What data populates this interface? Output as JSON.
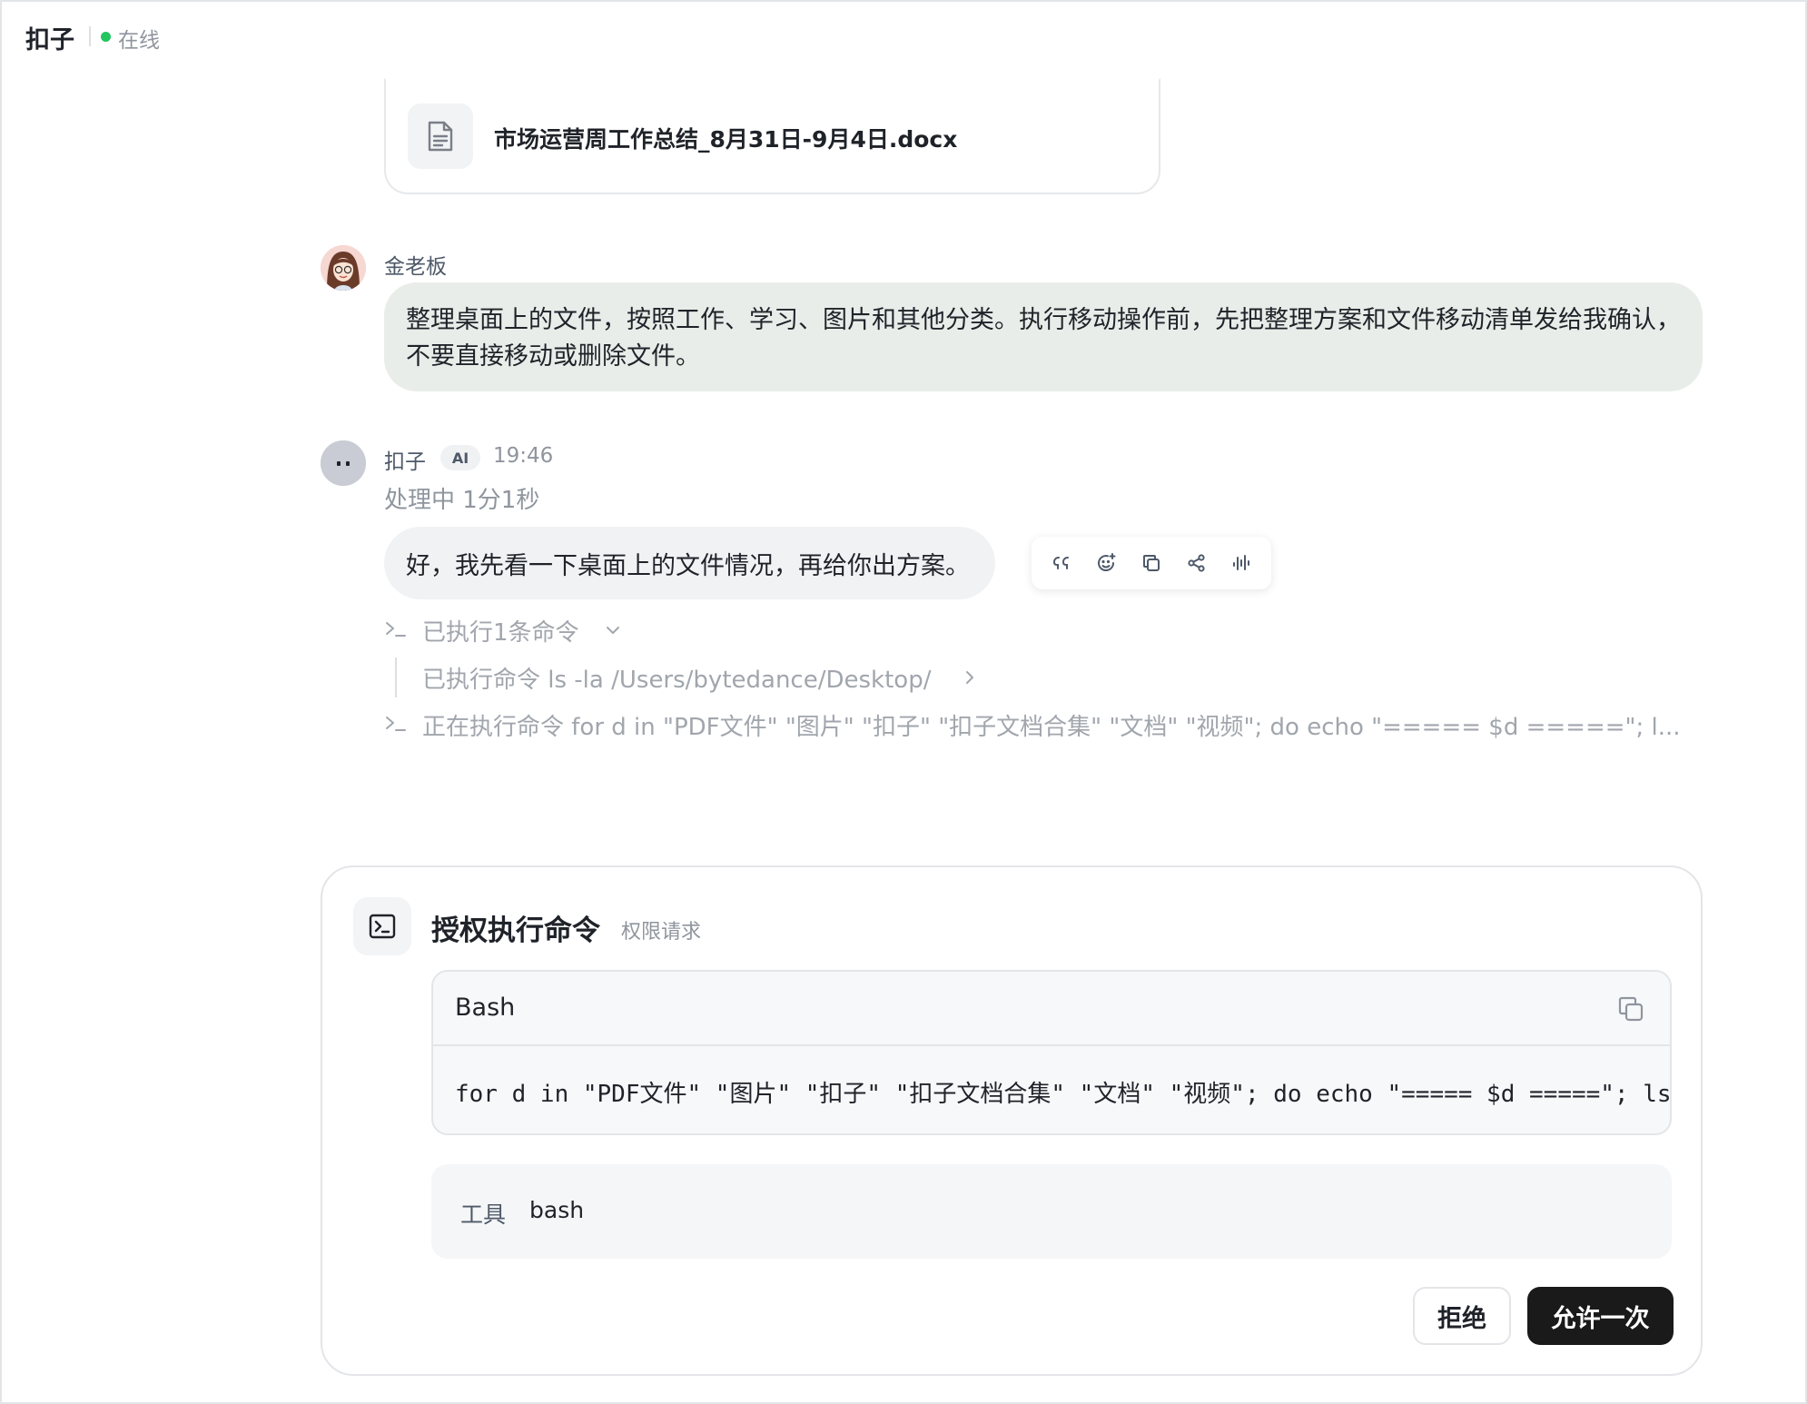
{
  "header": {
    "title": "扣子",
    "status": "在线",
    "status_color": "#22c55e"
  },
  "file_card": {
    "file_name": "市场运营周工作总结_8月31日-9月4日.docx",
    "icon": "document-icon"
  },
  "user_message": {
    "name": "金老板",
    "text": "整理桌面上的文件，按照工作、学习、图片和其他分类。执行移动操作前，先把整理方案和文件移动清单发给我确认，不要直接移动或删除文件。"
  },
  "bot_message": {
    "name": "扣子",
    "badge": "AI",
    "time": "19:46",
    "status": "处理中 1分1秒",
    "text": "好，我先看一下桌面上的文件情况，再给你出方案。",
    "actions": [
      "quote-icon",
      "emoji-reaction-icon",
      "copy-icon",
      "share-icon",
      "voice-icon"
    ]
  },
  "exec_logs": {
    "summary": "已执行1条命令",
    "executed": "已执行命令 ls -la /Users/bytedance/Desktop/",
    "running": "正在执行命令  for d in \"PDF文件\" \"图片\" \"扣子\" \"扣子文档合集\" \"文档\" \"视频\"; do echo \"===== $d =====\"; l..."
  },
  "permission": {
    "title": "授权执行命令",
    "subtitle": "权限请求",
    "code_language": "Bash",
    "code": "for d in \"PDF文件\" \"图片\" \"扣子\" \"扣子文档合集\" \"文档\" \"视频\"; do echo \"===== $d =====\"; ls",
    "tool_label": "工具",
    "tool_value": "bash",
    "reject_label": "拒绝",
    "allow_label": "允许一次"
  }
}
